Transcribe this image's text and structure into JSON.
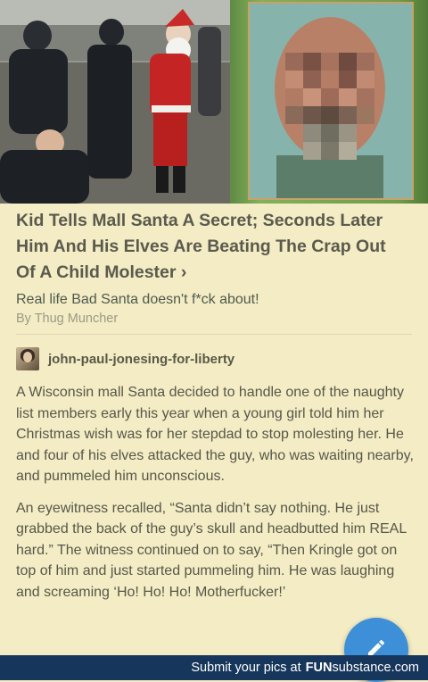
{
  "article": {
    "title": "Kid Tells Mall Santa A Secret; Seconds Later Him And His Elves Are Beating The Crap Out Of A Child Molester",
    "chevron": "›",
    "subtitle": "Real life Bad Santa doesn't f*ck about!",
    "byline": "By Thug Muncher"
  },
  "post": {
    "username": "john-paul-jonesing-for-liberty",
    "paragraphs": [
      "A Wisconsin mall Santa decided to handle one of the naughty list members early this year when a young girl told him her Christmas wish was for her stepdad to stop molesting her. He and four of his elves attacked the guy, who was waiting nearby, and pummeled him unconscious.",
      "An eyewitness recalled, “Santa didn’t say nothing. He just grabbed the back of the guy’s skull and headbutted him REAL hard.” The witness continued on to say, “Then Kringle got on top of him and just started pummeling him. He was laughing and screaming ‘Ho! Ho! Ho! Motherfucker!’"
    ]
  },
  "footer": {
    "prefix": "Submit your pics at",
    "brand_fun": "FUN",
    "brand_sub": "substance",
    "brand_com": ".com"
  },
  "icons": {
    "fab": "pencil-icon",
    "chevron": "chevron-right-icon"
  },
  "colors": {
    "background": "#f3ecc4",
    "fab": "#3d90d8",
    "footer": "#16365b"
  }
}
